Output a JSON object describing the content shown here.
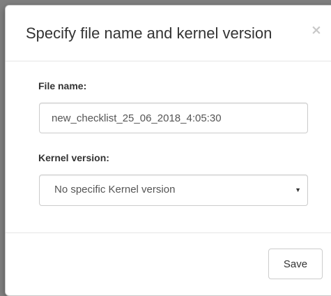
{
  "modal": {
    "title": "Specify file name and kernel version",
    "close_glyph": "×"
  },
  "form": {
    "file_name": {
      "label": "File name:",
      "value": "new_checklist_25_06_2018_4:05:30"
    },
    "kernel_version": {
      "label": "Kernel version:",
      "selected": "No specific Kernel version",
      "arrow_glyph": "▼"
    }
  },
  "footer": {
    "save_label": "Save"
  }
}
